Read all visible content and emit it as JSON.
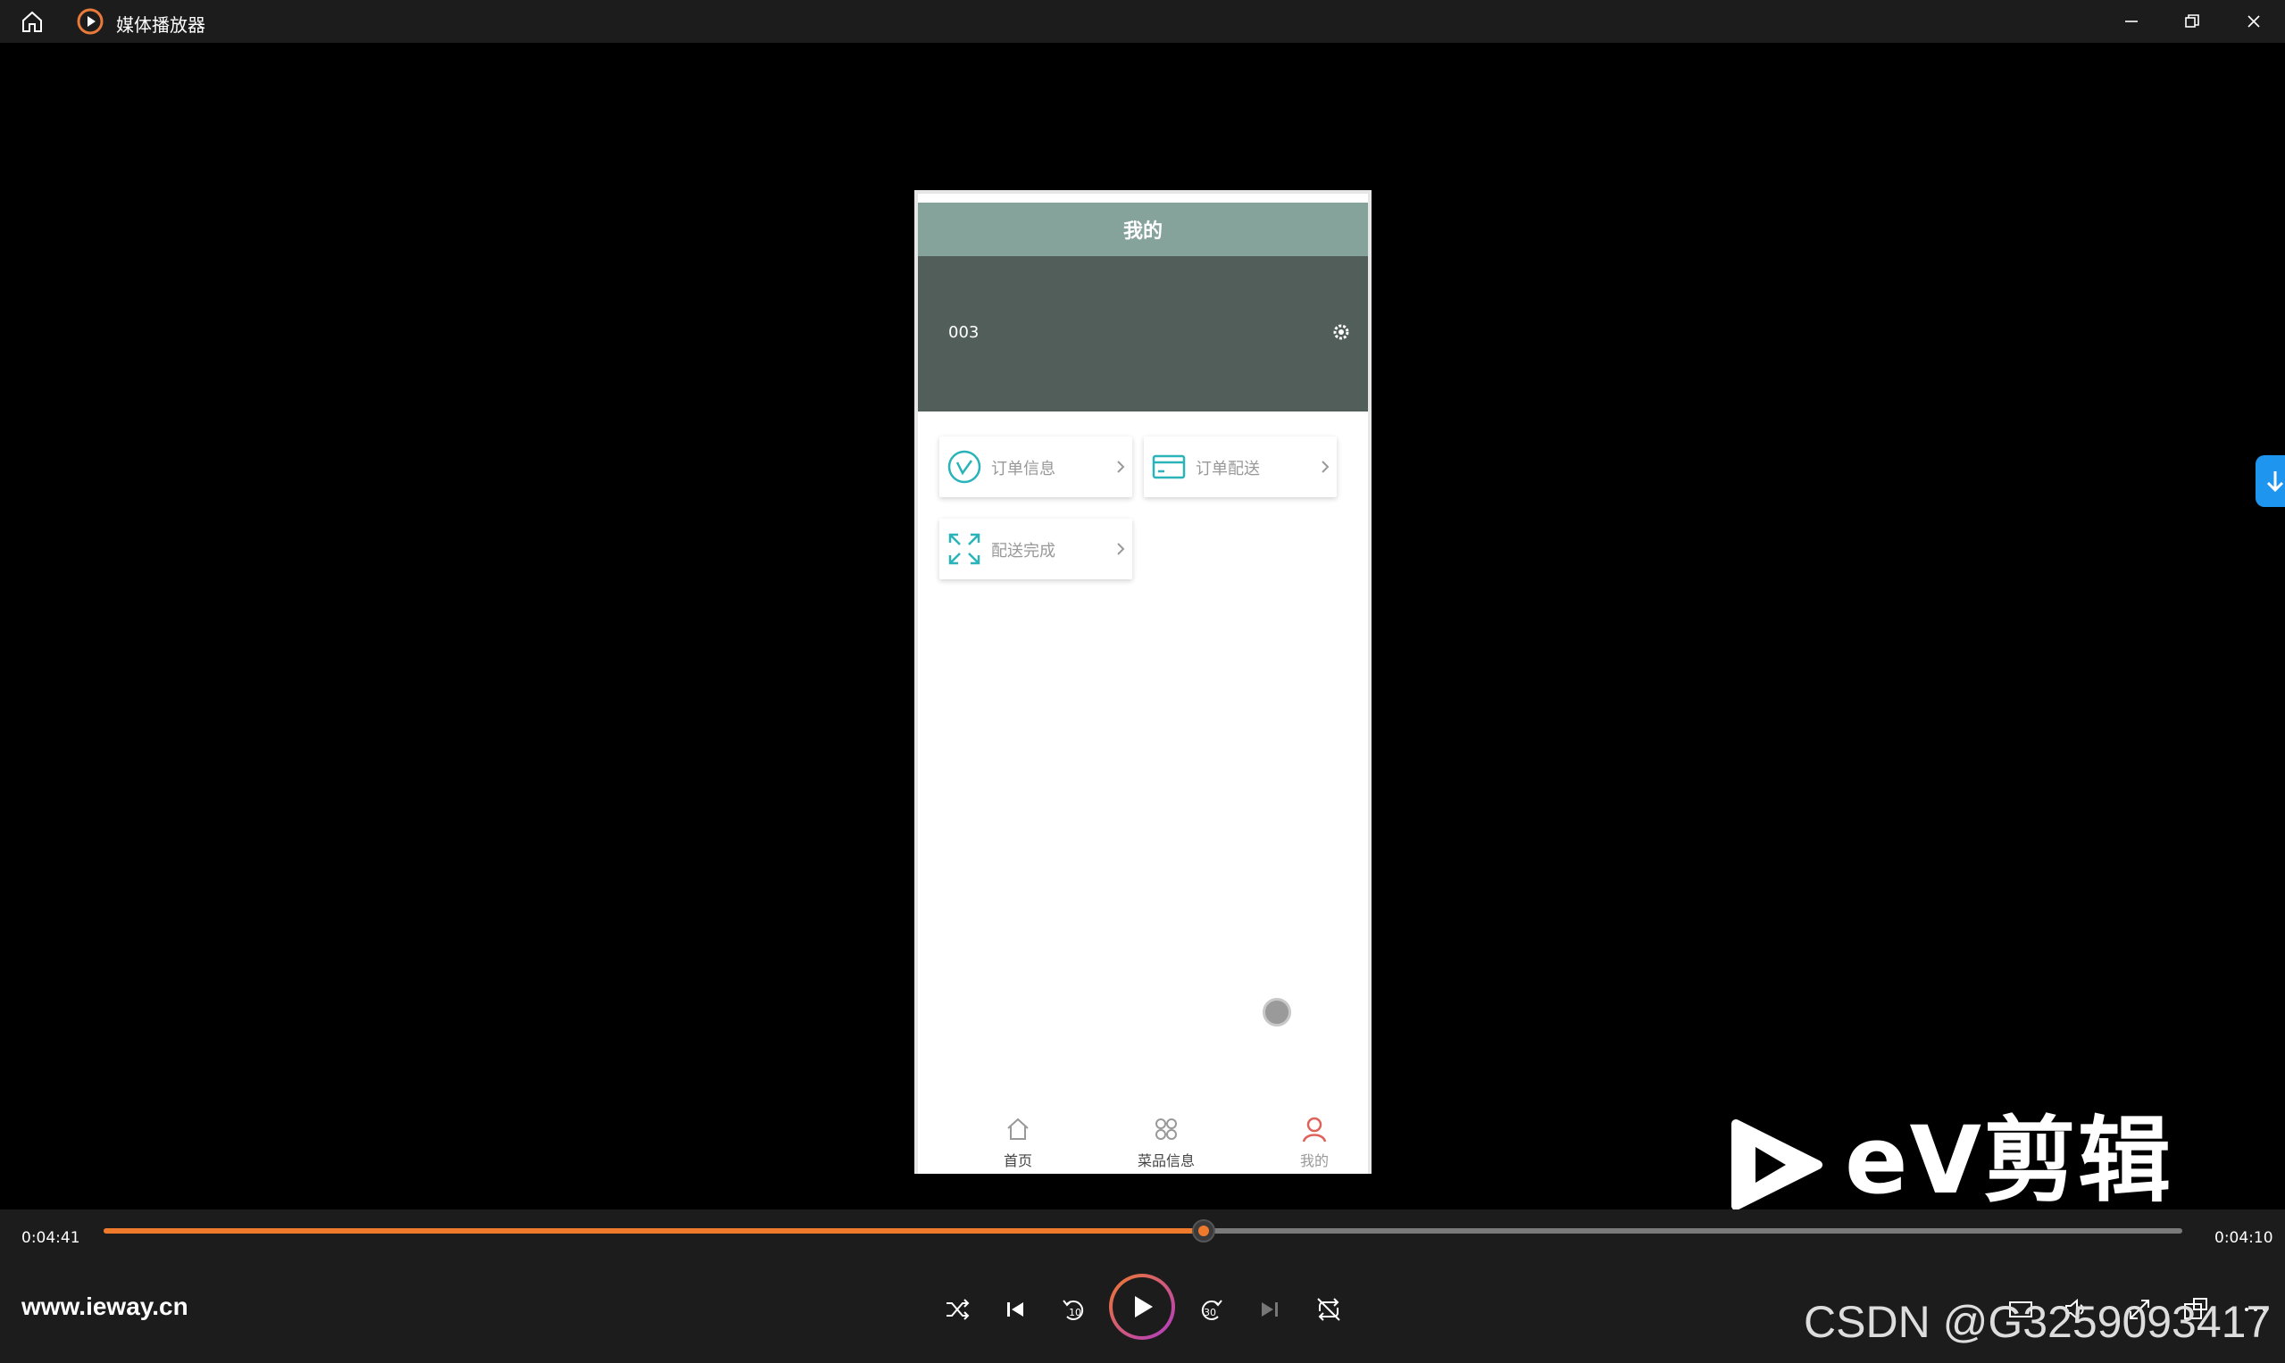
{
  "window": {
    "title": "媒体播放器",
    "controls": {
      "minimize": "minimize-icon",
      "maximize": "restore-icon",
      "close": "close-icon"
    }
  },
  "phone": {
    "header_title": "我的",
    "user_id": "003",
    "menu": [
      {
        "label": "订单信息",
        "icon": "chart-circle-icon"
      },
      {
        "label": "订单配送",
        "icon": "card-icon"
      },
      {
        "label": "配送完成",
        "icon": "expand-icon"
      }
    ],
    "tabs": [
      {
        "label": "首页",
        "icon": "home-icon"
      },
      {
        "label": "菜品信息",
        "icon": "grid-icon"
      },
      {
        "label": "我的",
        "icon": "user-icon",
        "active": true
      }
    ],
    "colors": {
      "header": "#86a39b",
      "user_panel": "#525e5a",
      "accent": "#2ab3b8",
      "active_tab": "#e0605a"
    }
  },
  "watermark": {
    "brand": "eV剪辑"
  },
  "player": {
    "elapsed": "0:04:41",
    "remaining": "0:04:10",
    "progress_fraction": 0.529,
    "site": "www.ieway.cn",
    "overlay_text": "CSDN @G3259093417",
    "accent_color": "#f07a2c"
  }
}
